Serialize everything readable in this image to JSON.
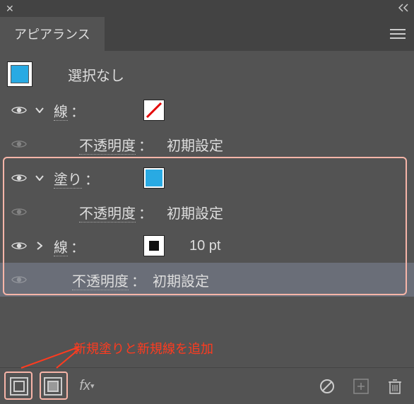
{
  "panel": {
    "title": "アピアランス",
    "selection_label": "選択なし",
    "selection_swatch_color": "#29aae3"
  },
  "rows": {
    "stroke1": {
      "label": "線",
      "colon": "："
    },
    "stroke1_opacity": {
      "label": "不透明度",
      "colon": "：",
      "value": "初期設定"
    },
    "fill": {
      "label": "塗り",
      "colon": "："
    },
    "fill_opacity": {
      "label": "不透明度",
      "colon": "：",
      "value": "初期設定"
    },
    "stroke2": {
      "label": "線",
      "colon": "：",
      "value": "10 pt"
    },
    "main_opacity": {
      "label": "不透明度",
      "colon": "：",
      "value": "初期設定"
    }
  },
  "annotation": {
    "text": "新規塗りと新規線を追加"
  },
  "footer": {
    "fx_label": "fx"
  }
}
